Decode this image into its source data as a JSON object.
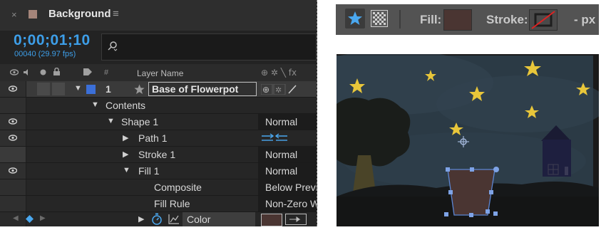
{
  "panel": {
    "tab_close": "×",
    "title": "Background",
    "menu": "≡",
    "timecode": "0;00;01;10",
    "frames": "00040 (29.97 fps)",
    "search_glyph": "⌕"
  },
  "columns": {
    "hash": "#",
    "layer_name": "Layer Name"
  },
  "layer": {
    "number": "1",
    "name": "Base of Flowerpot"
  },
  "rows": [
    {
      "label": "Contents"
    },
    {
      "label": "Shape 1",
      "mode": "Normal"
    },
    {
      "label": "Path 1"
    },
    {
      "label": "Stroke 1",
      "mode": "Normal"
    },
    {
      "label": "Fill 1",
      "mode": "Normal"
    },
    {
      "label": "Composite",
      "mode": "Below Previous"
    },
    {
      "label": "Fill Rule",
      "mode": "Non-Zero Winding"
    },
    {
      "label": "Color"
    }
  ],
  "toolbar": {
    "fill_label": "Fill:",
    "stroke_label": "Stroke:",
    "px_label": "- px"
  },
  "colors": {
    "accent": "#3d9ee8",
    "fill": "#4a3532",
    "sky": "#2b3a45",
    "star": "#e8c63a",
    "house": "#1e1f3f"
  },
  "icons": [
    "close-icon",
    "menu-icon",
    "search-icon",
    "eye-icon",
    "audio-icon",
    "solo-icon",
    "lock-icon",
    "label-icon",
    "star-icon",
    "transparency-grid-icon",
    "stopwatch-icon",
    "graph-icon",
    "keyframe-diamond-icon"
  ]
}
